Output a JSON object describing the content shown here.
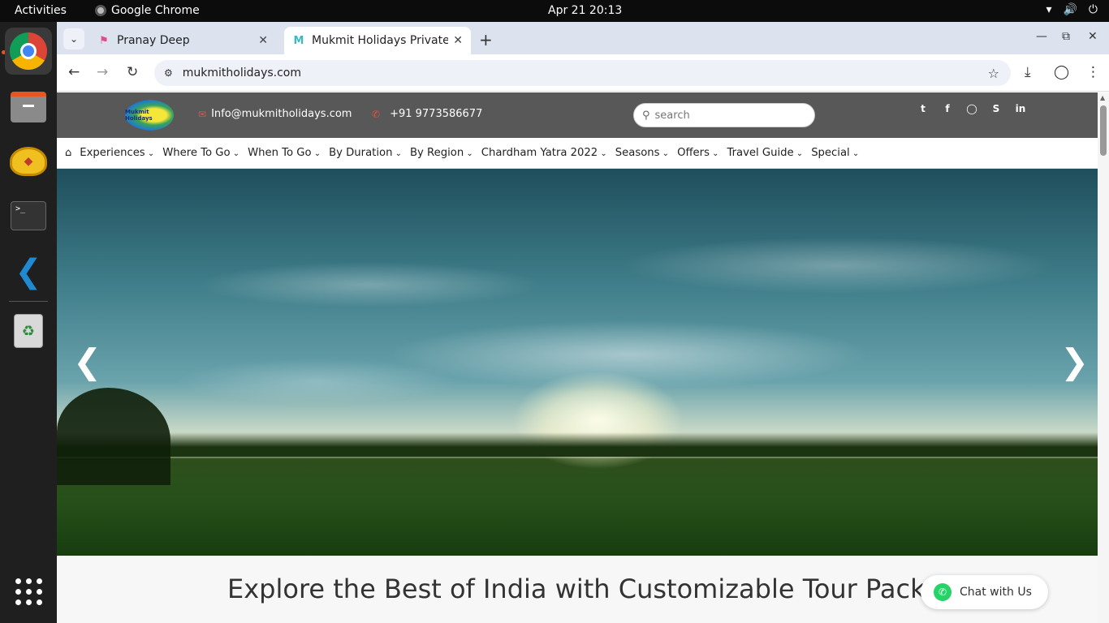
{
  "topbar": {
    "activities": "Activities",
    "app_name": "Google Chrome",
    "clock": "Apr 21  20:13"
  },
  "dock": {
    "items": [
      {
        "name": "chrome-icon"
      },
      {
        "name": "files-icon"
      },
      {
        "name": "genie-icon"
      },
      {
        "name": "terminal-icon"
      },
      {
        "name": "vscode-icon"
      },
      {
        "name": "trash-icon"
      },
      {
        "name": "app-grid-icon"
      }
    ]
  },
  "browser": {
    "tabs": [
      {
        "title": "Pranay Deep",
        "active": false
      },
      {
        "title": "Mukmit Holidays Private",
        "active": true
      }
    ],
    "url": "mukmitholidays.com"
  },
  "site": {
    "logo_text": "Mukmit Holidays",
    "email": "Info@mukmitholidays.com",
    "phone": "+91 9773586677",
    "search_placeholder": "search",
    "socials": [
      "twitter-icon",
      "facebook-icon",
      "instagram-icon",
      "skype-icon",
      "linkedin-icon"
    ],
    "menu": [
      "Experiences",
      "Where To Go",
      "When To Go",
      "By Duration",
      "By Region",
      "Chardham Yatra 2022",
      "Seasons",
      "Offers",
      "Travel Guide",
      "Special"
    ],
    "heading": "Explore the Best of India with Customizable Tour Packages",
    "chat_label": "Chat with Us"
  },
  "colors": {
    "site_header_bg": "#585858",
    "accent_icon": "#e0563b",
    "whatsapp": "#25d366"
  }
}
